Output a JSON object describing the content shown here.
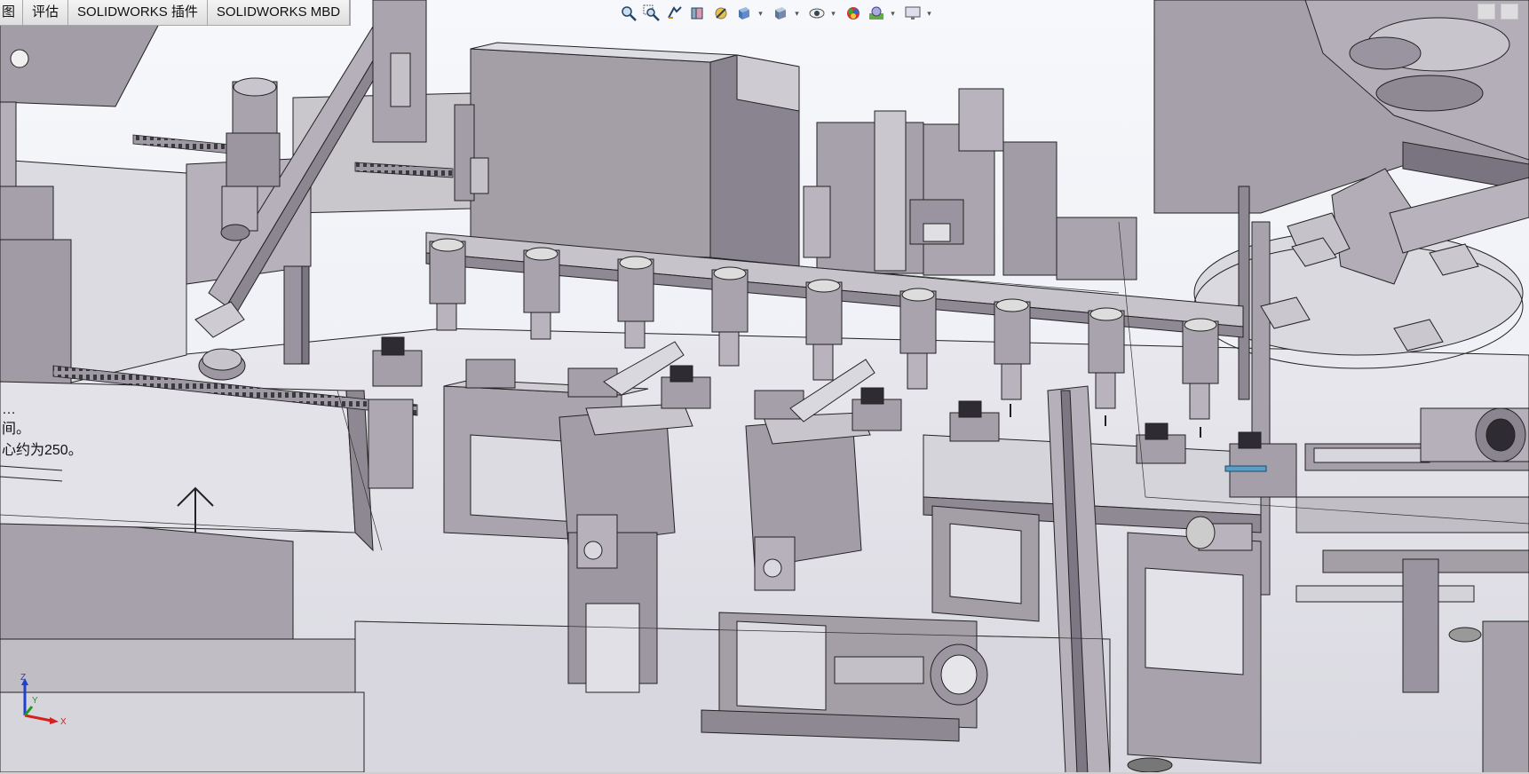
{
  "tabs": [
    {
      "label": "图"
    },
    {
      "label": "评估"
    },
    {
      "label": "SOLIDWORKS 插件"
    },
    {
      "label": "SOLIDWORKS MBD"
    }
  ],
  "heads_up_toolbar": [
    {
      "icon": "zoom-to-fit-icon",
      "has_dropdown": false
    },
    {
      "icon": "zoom-to-area-icon",
      "has_dropdown": false
    },
    {
      "icon": "previous-view-icon",
      "has_dropdown": false
    },
    {
      "icon": "section-view-icon",
      "has_dropdown": false
    },
    {
      "icon": "dynamic-annotation-icon",
      "has_dropdown": false
    },
    {
      "icon": "view-orientation-icon",
      "has_dropdown": true
    },
    {
      "icon": "display-style-icon",
      "has_dropdown": true
    },
    {
      "icon": "hide-show-items-icon",
      "has_dropdown": true
    },
    {
      "icon": "edit-appearance-icon",
      "has_dropdown": false
    },
    {
      "icon": "apply-scene-icon",
      "has_dropdown": true
    },
    {
      "icon": "view-settings-icon",
      "has_dropdown": true
    }
  ],
  "annotation_note": {
    "line1": "…",
    "line2": "间。",
    "line3": "心约为250。"
  },
  "triad": {
    "x_label": "X",
    "y_label": "Y",
    "z_label": "Z"
  },
  "colors": {
    "part_face": "#a49ea7",
    "part_face_light": "#c7c3ca",
    "part_face_dark": "#7a7480",
    "edge": "#1a1a1a",
    "background_top": "#f7f8fb",
    "triad_x": "#d62020",
    "triad_y": "#1f9a1f",
    "triad_z": "#2040d0"
  }
}
